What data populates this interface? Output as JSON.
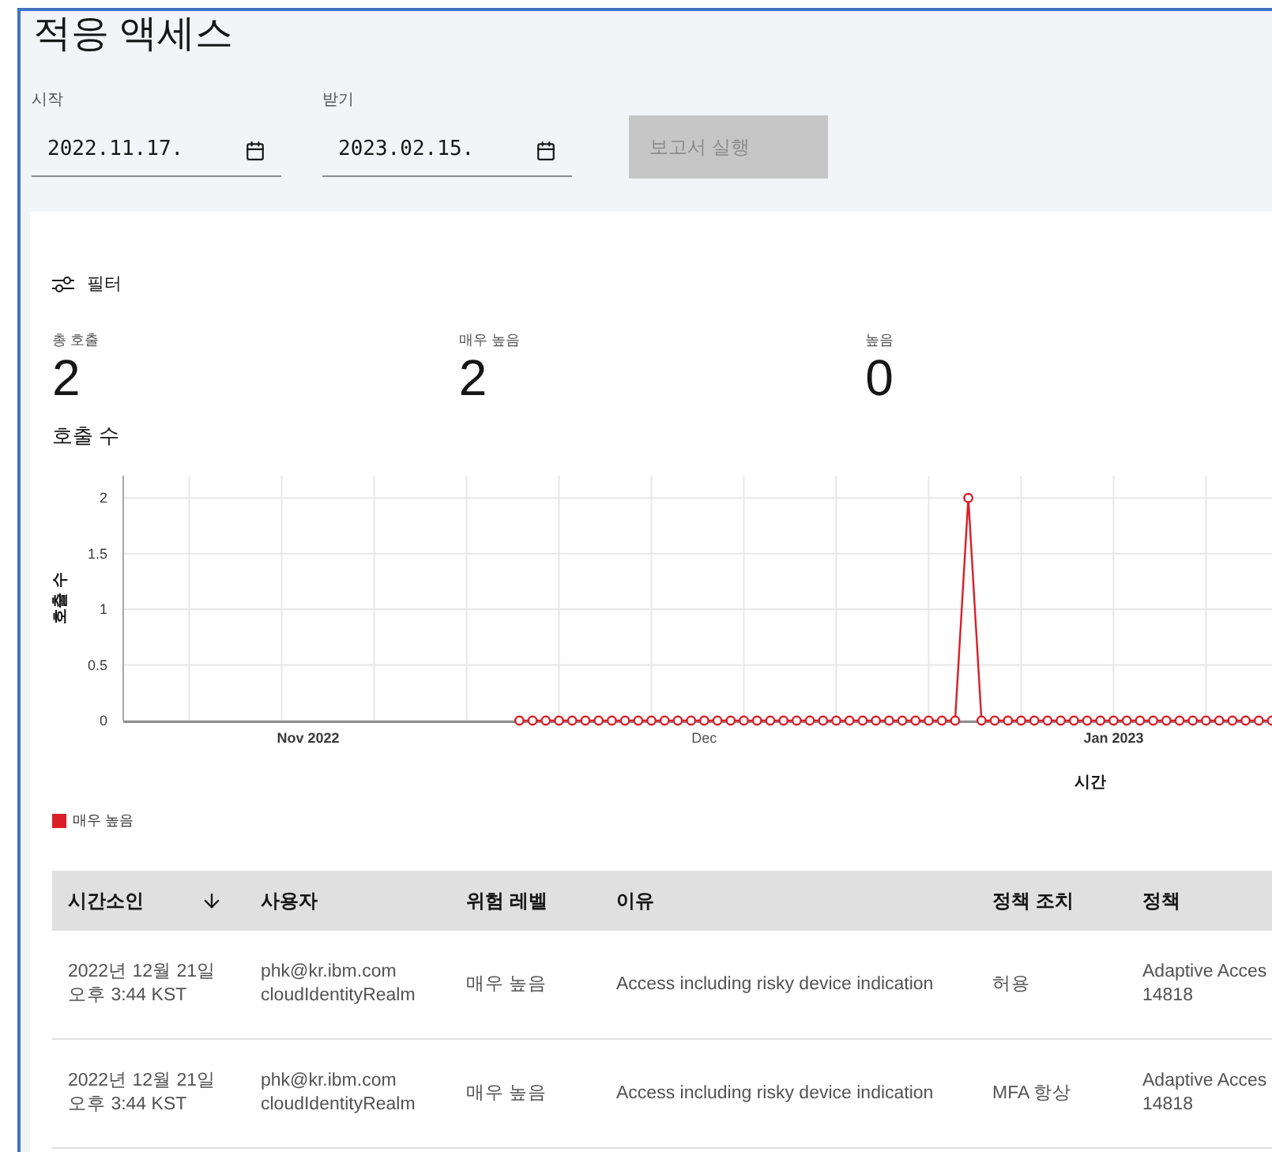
{
  "page": {
    "title": "적응 액세스"
  },
  "date_fields": [
    {
      "label": "시작",
      "value": "2022.11.17."
    },
    {
      "label": "받기",
      "value": "2023.02.15."
    }
  ],
  "run_button": {
    "label": "보고서 실행",
    "disabled": true
  },
  "filter": {
    "label": "필터"
  },
  "stats": [
    {
      "label": "총 호출",
      "value": "2"
    },
    {
      "label": "매우 높음",
      "value": "2"
    },
    {
      "label": "높음",
      "value": "0"
    }
  ],
  "chart_section": {
    "title": "호출 수",
    "chart_data": {
      "type": "line",
      "xlabel": "시간",
      "ylabel": "호출 수",
      "categories": [
        null,
        null,
        null,
        null,
        null,
        null,
        null,
        null,
        null,
        null,
        null,
        null,
        null,
        null,
        "Nov 2022",
        null,
        null,
        null,
        null,
        null,
        null,
        null,
        null,
        null,
        null,
        null,
        null,
        null,
        null,
        null,
        null,
        null,
        null,
        null,
        null,
        null,
        null,
        null,
        null,
        null,
        null,
        null,
        null,
        null,
        "Dec",
        null,
        null,
        null,
        null,
        null,
        null,
        null,
        null,
        null,
        null,
        null,
        null,
        null,
        null,
        null,
        null,
        null,
        null,
        null,
        null,
        null,
        null,
        null,
        null,
        null,
        null,
        null,
        null,
        null,
        null,
        "Jan 2023",
        null,
        null,
        null,
        null,
        null,
        null,
        null,
        null,
        null,
        null,
        null,
        null
      ],
      "grid": true,
      "series": [
        {
          "name": "매우 높음",
          "color": "#da1e28",
          "marker": "circle",
          "values": [
            null,
            null,
            null,
            null,
            null,
            null,
            null,
            null,
            null,
            null,
            null,
            null,
            null,
            null,
            null,
            null,
            null,
            null,
            null,
            null,
            null,
            null,
            null,
            null,
            null,
            null,
            null,
            null,
            null,
            null,
            0,
            0,
            0,
            0,
            0,
            0,
            0,
            0,
            0,
            0,
            0,
            0,
            0,
            0,
            0,
            0,
            0,
            0,
            0,
            0,
            0,
            0,
            0,
            0,
            0,
            0,
            0,
            0,
            0,
            0,
            0,
            0,
            0,
            0,
            2,
            0,
            0,
            0,
            0,
            0,
            0,
            0,
            0,
            0,
            0,
            0,
            0,
            0,
            0,
            0,
            0,
            0,
            0,
            0,
            0,
            0,
            0,
            0
          ]
        }
      ],
      "ylim": [
        0,
        2.2
      ],
      "yticks": [
        0,
        0.5,
        1,
        1.5,
        2
      ]
    }
  },
  "table": {
    "columns": [
      {
        "label": "시간소인",
        "sorted": true
      },
      {
        "label": "사용자",
        "sorted": false
      },
      {
        "label": "위험 레벨",
        "sorted": false
      },
      {
        "label": "이유",
        "sorted": false
      },
      {
        "label": "정책 조치",
        "sorted": false
      },
      {
        "label": "정책",
        "sorted": false
      }
    ],
    "rows": [
      {
        "cells": [
          [
            "2022년 12월 21일",
            "오후 3:44 KST"
          ],
          [
            "phk@kr.ibm.com",
            "cloudIdentityRealm"
          ],
          [
            "매우 높음"
          ],
          [
            "Access including risky device indication"
          ],
          [
            "허용"
          ],
          [
            "Adaptive Acces",
            "14818"
          ]
        ]
      },
      {
        "cells": [
          [
            "2022년 12월 21일",
            "오후 3:44 KST"
          ],
          [
            "phk@kr.ibm.com",
            "cloudIdentityRealm"
          ],
          [
            "매우 높음"
          ],
          [
            "Access including risky device indication"
          ],
          [
            "MFA 항상"
          ],
          [
            "Adaptive Acces",
            "14818"
          ]
        ]
      }
    ]
  }
}
